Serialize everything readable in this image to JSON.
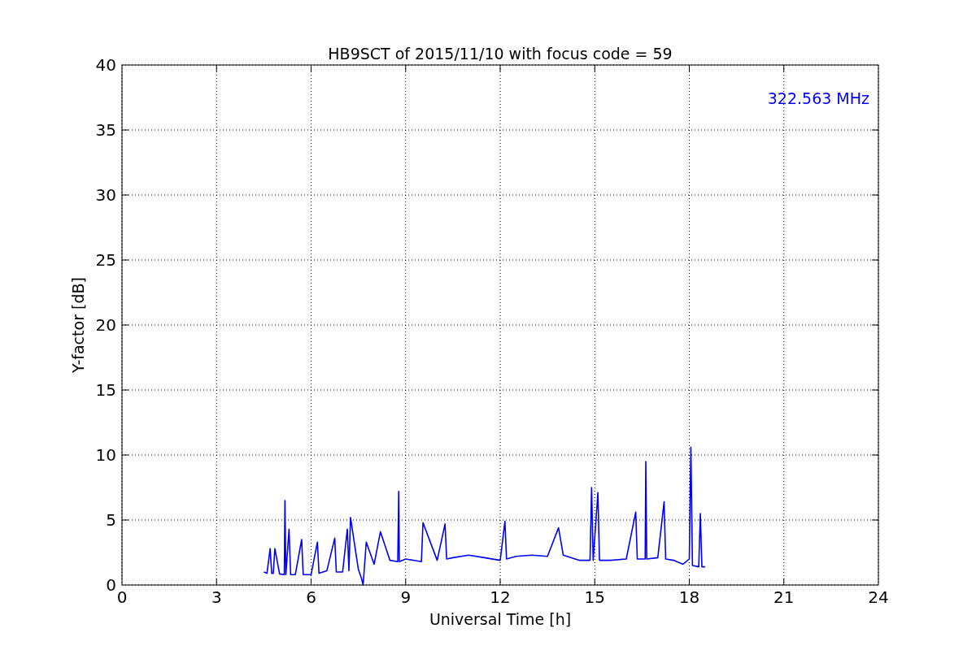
{
  "chart_data": {
    "type": "line",
    "title": "HB9SCT of 2015/11/10 with focus code = 59",
    "xlabel": "Universal Time [h]",
    "ylabel": "Y-factor [dB]",
    "x": [
      4.5,
      4.6,
      4.7,
      4.75,
      4.8,
      4.85,
      5.0,
      5.15,
      5.17,
      5.2,
      5.3,
      5.35,
      5.5,
      5.7,
      5.75,
      5.85,
      6.0,
      6.2,
      6.25,
      6.5,
      6.75,
      6.8,
      7.0,
      7.15,
      7.2,
      7.25,
      7.5,
      7.6,
      7.65,
      7.75,
      8.0,
      8.2,
      8.5,
      8.75,
      8.78,
      8.8,
      9.0,
      9.5,
      9.55,
      10.0,
      10.25,
      10.3,
      10.5,
      11.0,
      11.5,
      12.0,
      12.15,
      12.2,
      12.5,
      13.0,
      13.5,
      13.85,
      14.0,
      14.5,
      14.85,
      14.9,
      14.95,
      15.1,
      15.15,
      15.5,
      16.0,
      16.3,
      16.35,
      16.6,
      16.62,
      16.65,
      17.0,
      17.2,
      17.25,
      17.5,
      17.8,
      18.0,
      18.05,
      18.1,
      18.3,
      18.35,
      18.4,
      18.5
    ],
    "series": [
      {
        "name": "322.563 MHz",
        "color": "#0000ff",
        "values": [
          1.0,
          0.9,
          2.8,
          0.9,
          0.9,
          2.8,
          0.85,
          0.8,
          6.5,
          0.8,
          4.3,
          0.8,
          0.8,
          3.5,
          0.8,
          0.8,
          0.8,
          3.3,
          0.9,
          1.1,
          3.6,
          1.0,
          1.0,
          4.3,
          1.1,
          5.2,
          1.2,
          0.5,
          0.0,
          3.3,
          1.6,
          4.1,
          1.9,
          1.8,
          7.2,
          1.8,
          2.0,
          1.8,
          4.8,
          1.9,
          4.7,
          2.0,
          2.1,
          2.3,
          2.1,
          1.9,
          4.9,
          2.0,
          2.2,
          2.3,
          2.2,
          4.4,
          2.3,
          1.9,
          1.9,
          7.5,
          1.9,
          7.1,
          1.9,
          1.9,
          2.0,
          5.6,
          2.0,
          2.0,
          9.5,
          2.0,
          2.1,
          6.4,
          2.0,
          1.9,
          1.6,
          2.0,
          10.6,
          1.5,
          1.4,
          5.5,
          1.4,
          1.4
        ]
      }
    ],
    "xlim": [
      0,
      24
    ],
    "ylim": [
      0,
      40
    ],
    "xticks": [
      0,
      3,
      6,
      9,
      12,
      15,
      18,
      21,
      24
    ],
    "yticks": [
      0,
      5,
      10,
      15,
      20,
      25,
      30,
      35,
      40
    ],
    "grid": true
  }
}
